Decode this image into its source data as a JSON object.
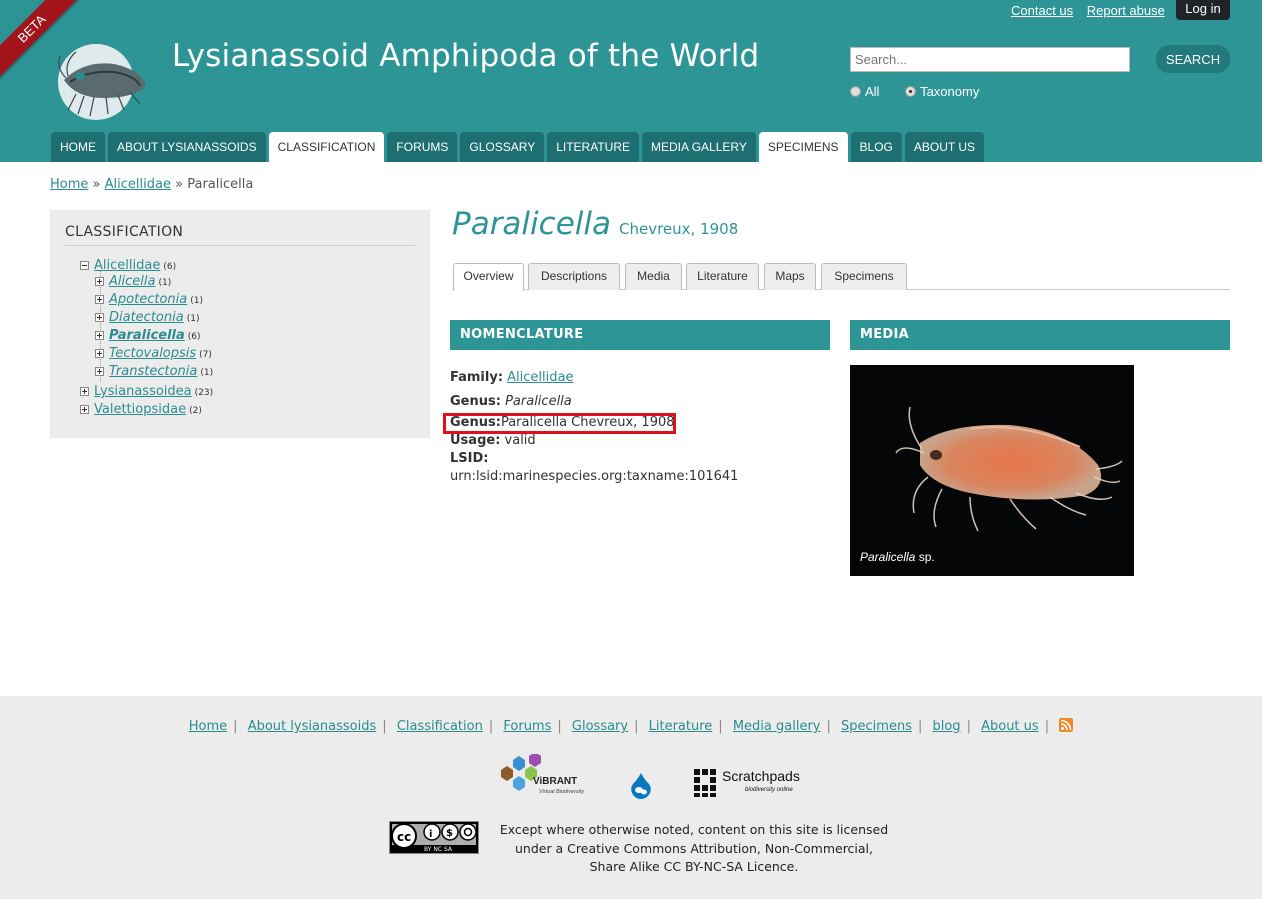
{
  "header": {
    "beta_label": "BETA",
    "site_name": "Lysianassoid Amphipoda of the World",
    "top_links": [
      "Contact us",
      "Report abuse"
    ],
    "login_label": "Log in",
    "search": {
      "placeholder": "Search...",
      "button_label": "SEARCH",
      "scopes": [
        "All",
        "Taxonomy"
      ],
      "selected_scope": "Taxonomy"
    },
    "nav": [
      {
        "label": "HOME",
        "active": false
      },
      {
        "label": "ABOUT LYSIANASSOIDS",
        "active": false
      },
      {
        "label": "CLASSIFICATION",
        "active": true
      },
      {
        "label": "FORUMS",
        "active": false
      },
      {
        "label": "GLOSSARY",
        "active": false
      },
      {
        "label": "LITERATURE",
        "active": false
      },
      {
        "label": "MEDIA GALLERY",
        "active": false
      },
      {
        "label": "SPECIMENS",
        "active": true
      },
      {
        "label": "BLOG",
        "active": false
      },
      {
        "label": "ABOUT US",
        "active": false
      }
    ]
  },
  "breadcrumb": {
    "home": "Home",
    "sep": "»",
    "family": "Alicellidae",
    "current": "Paralicella"
  },
  "sidebar": {
    "title": "CLASSIFICATION",
    "tree": [
      {
        "label": "Alicellidae",
        "count": "(6)",
        "level": 0,
        "expanded": true
      },
      {
        "label": "Alicella",
        "count": "(1)",
        "level": 1
      },
      {
        "label": "Apotectonia",
        "count": "(1)",
        "level": 1
      },
      {
        "label": "Diatectonia",
        "count": "(1)",
        "level": 1
      },
      {
        "label": "Paralicella",
        "count": "(6)",
        "level": 1,
        "current": true
      },
      {
        "label": "Tectovalopsis",
        "count": "(7)",
        "level": 1
      },
      {
        "label": "Transtectonia",
        "count": "(1)",
        "level": 1
      },
      {
        "label": "Lysianassoidea",
        "count": "(23)",
        "level": 0
      },
      {
        "label": "Valettiopsidae",
        "count": "(2)",
        "level": 0
      }
    ]
  },
  "taxon": {
    "name": "Paralicella",
    "author": "Chevreux, 1908"
  },
  "tabs": [
    "Overview",
    "Descriptions",
    "Media",
    "Literature",
    "Maps",
    "Specimens"
  ],
  "active_tab": "Overview",
  "nomenclature": {
    "title": "NOMENCLATURE",
    "family_label": "Family:",
    "family_value": "Alicellidae",
    "genus_label": "Genus:",
    "genus_value": "Paralicella",
    "genus2_label": "Genus:",
    "genus2_value": "Paralicella Chevreux, 1908",
    "usage_label": "Usage:",
    "usage_value": "valid",
    "lsid_label": "LSID:",
    "lsid_value": "urn:lsid:marinespecies.org:taxname:101641"
  },
  "media": {
    "title": "MEDIA",
    "caption_italic": "Paralicella",
    "caption_rest": " sp."
  },
  "footer": {
    "links": [
      "Home",
      "About lysianassoids",
      "Classification",
      "Forums",
      "Glossary",
      "Literature",
      "Media gallery",
      "Specimens",
      "blog",
      "About us"
    ],
    "vibrant_label": "ViBRANT",
    "vibrant_sub": "Virtual Biodiversity",
    "scratchpads_label": "Scratchpads",
    "scratchpads_sub": "biodiversity online",
    "cc_badge": "BY NC SA",
    "licence_lines": [
      "Except where otherwise noted, content on this site is licensed",
      "under a Creative Commons Attribution, Non-Commercial,",
      "Share Alike CC BY-NC-SA Licence."
    ]
  },
  "colors": {
    "brand_teal": "#2e9597",
    "nav_dark": "#1e6f72",
    "beta_red": "#a3131b",
    "highlight_red": "#e0101c"
  }
}
